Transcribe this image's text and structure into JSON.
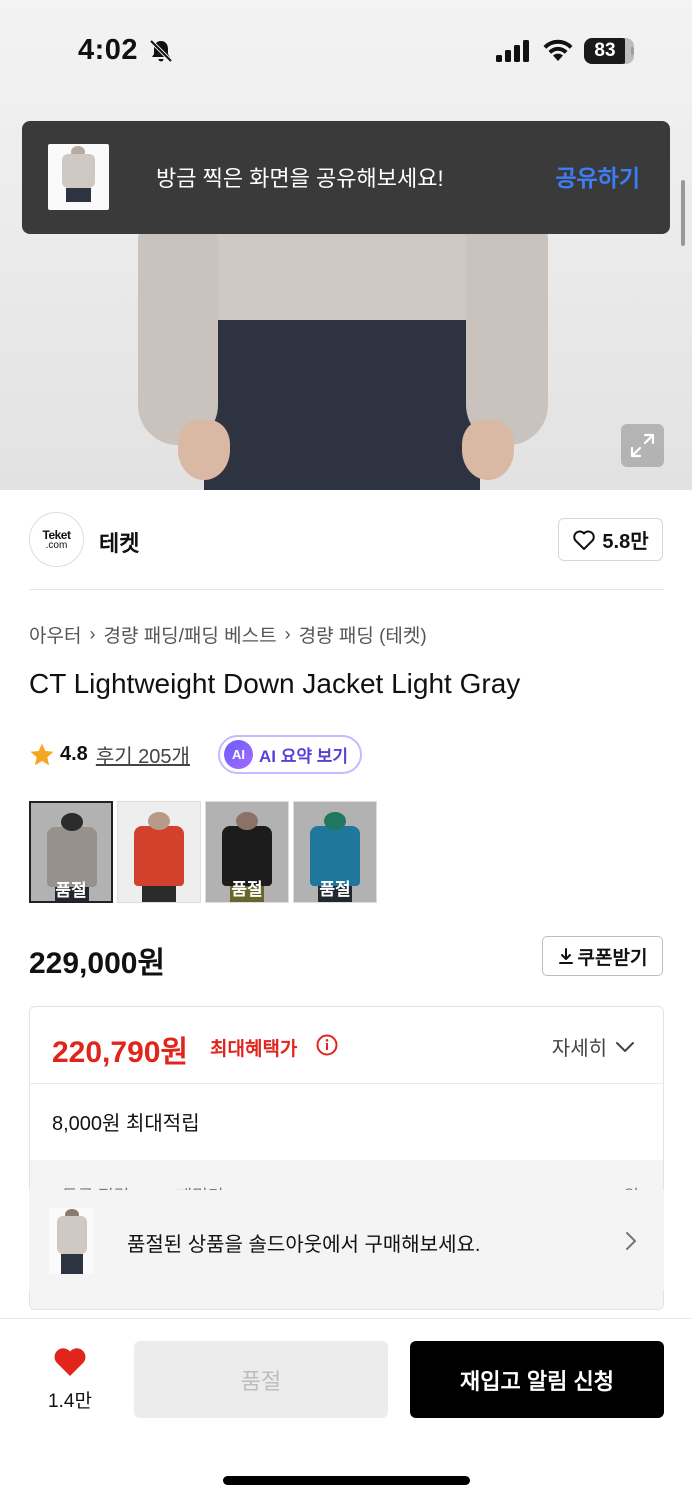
{
  "status_bar": {
    "time": "4:02",
    "battery": "83"
  },
  "toast": {
    "message": "방금 찍은 화면을 공유해보세요!",
    "action": "공유하기"
  },
  "brand": {
    "logo_line1": "Teket",
    "logo_line2": ".com",
    "name": "테켓",
    "likes": "5.8만"
  },
  "breadcrumb": [
    "아우터",
    "경량 패딩/패딩 베스트",
    "경량 패딩 (테켓)"
  ],
  "product": {
    "title": "CT Lightweight Down Jacket Light Gray",
    "rating": "4.8",
    "reviews": "후기 205개",
    "ai_badge": "AI",
    "ai_summary": "AI 요약 보기",
    "price": "229,000원",
    "coupon": "쿠폰받기"
  },
  "color_options": [
    {
      "name": "light-gray",
      "label": "품절",
      "soldout": true,
      "body_color": "#c9c2bd",
      "legs_color": "#2e3342"
    },
    {
      "name": "red",
      "label": "",
      "soldout": false,
      "body_color": "#d2412b",
      "legs_color": "#2b2b2b"
    },
    {
      "name": "black",
      "label": "품절",
      "soldout": true,
      "body_color": "#262626",
      "legs_color": "#8a8a3a"
    },
    {
      "name": "blue",
      "label": "품절",
      "soldout": true,
      "body_color": "#2a9fd0",
      "legs_color": "#2e3342"
    }
  ],
  "benefit": {
    "max_price": "220,790원",
    "max_label": "최대혜택가",
    "detail": "자세히",
    "points": "8,000원 최대적립",
    "peek_left": "등급 적립 (LV.2 패밀리 · 0.5%)",
    "peek_right": "1100원"
  },
  "soldout_banner": {
    "text": "품절된 상품을 솔드아웃에서 구매해보세요."
  },
  "bottom_bar": {
    "favorites": "1.4만",
    "soldout_button": "품절",
    "restock_button": "재입고 알림 신청"
  },
  "colors": {
    "accent_red": "#e1251b",
    "link_blue": "#3d7df5",
    "ai_purple": "#5a3fd8"
  }
}
